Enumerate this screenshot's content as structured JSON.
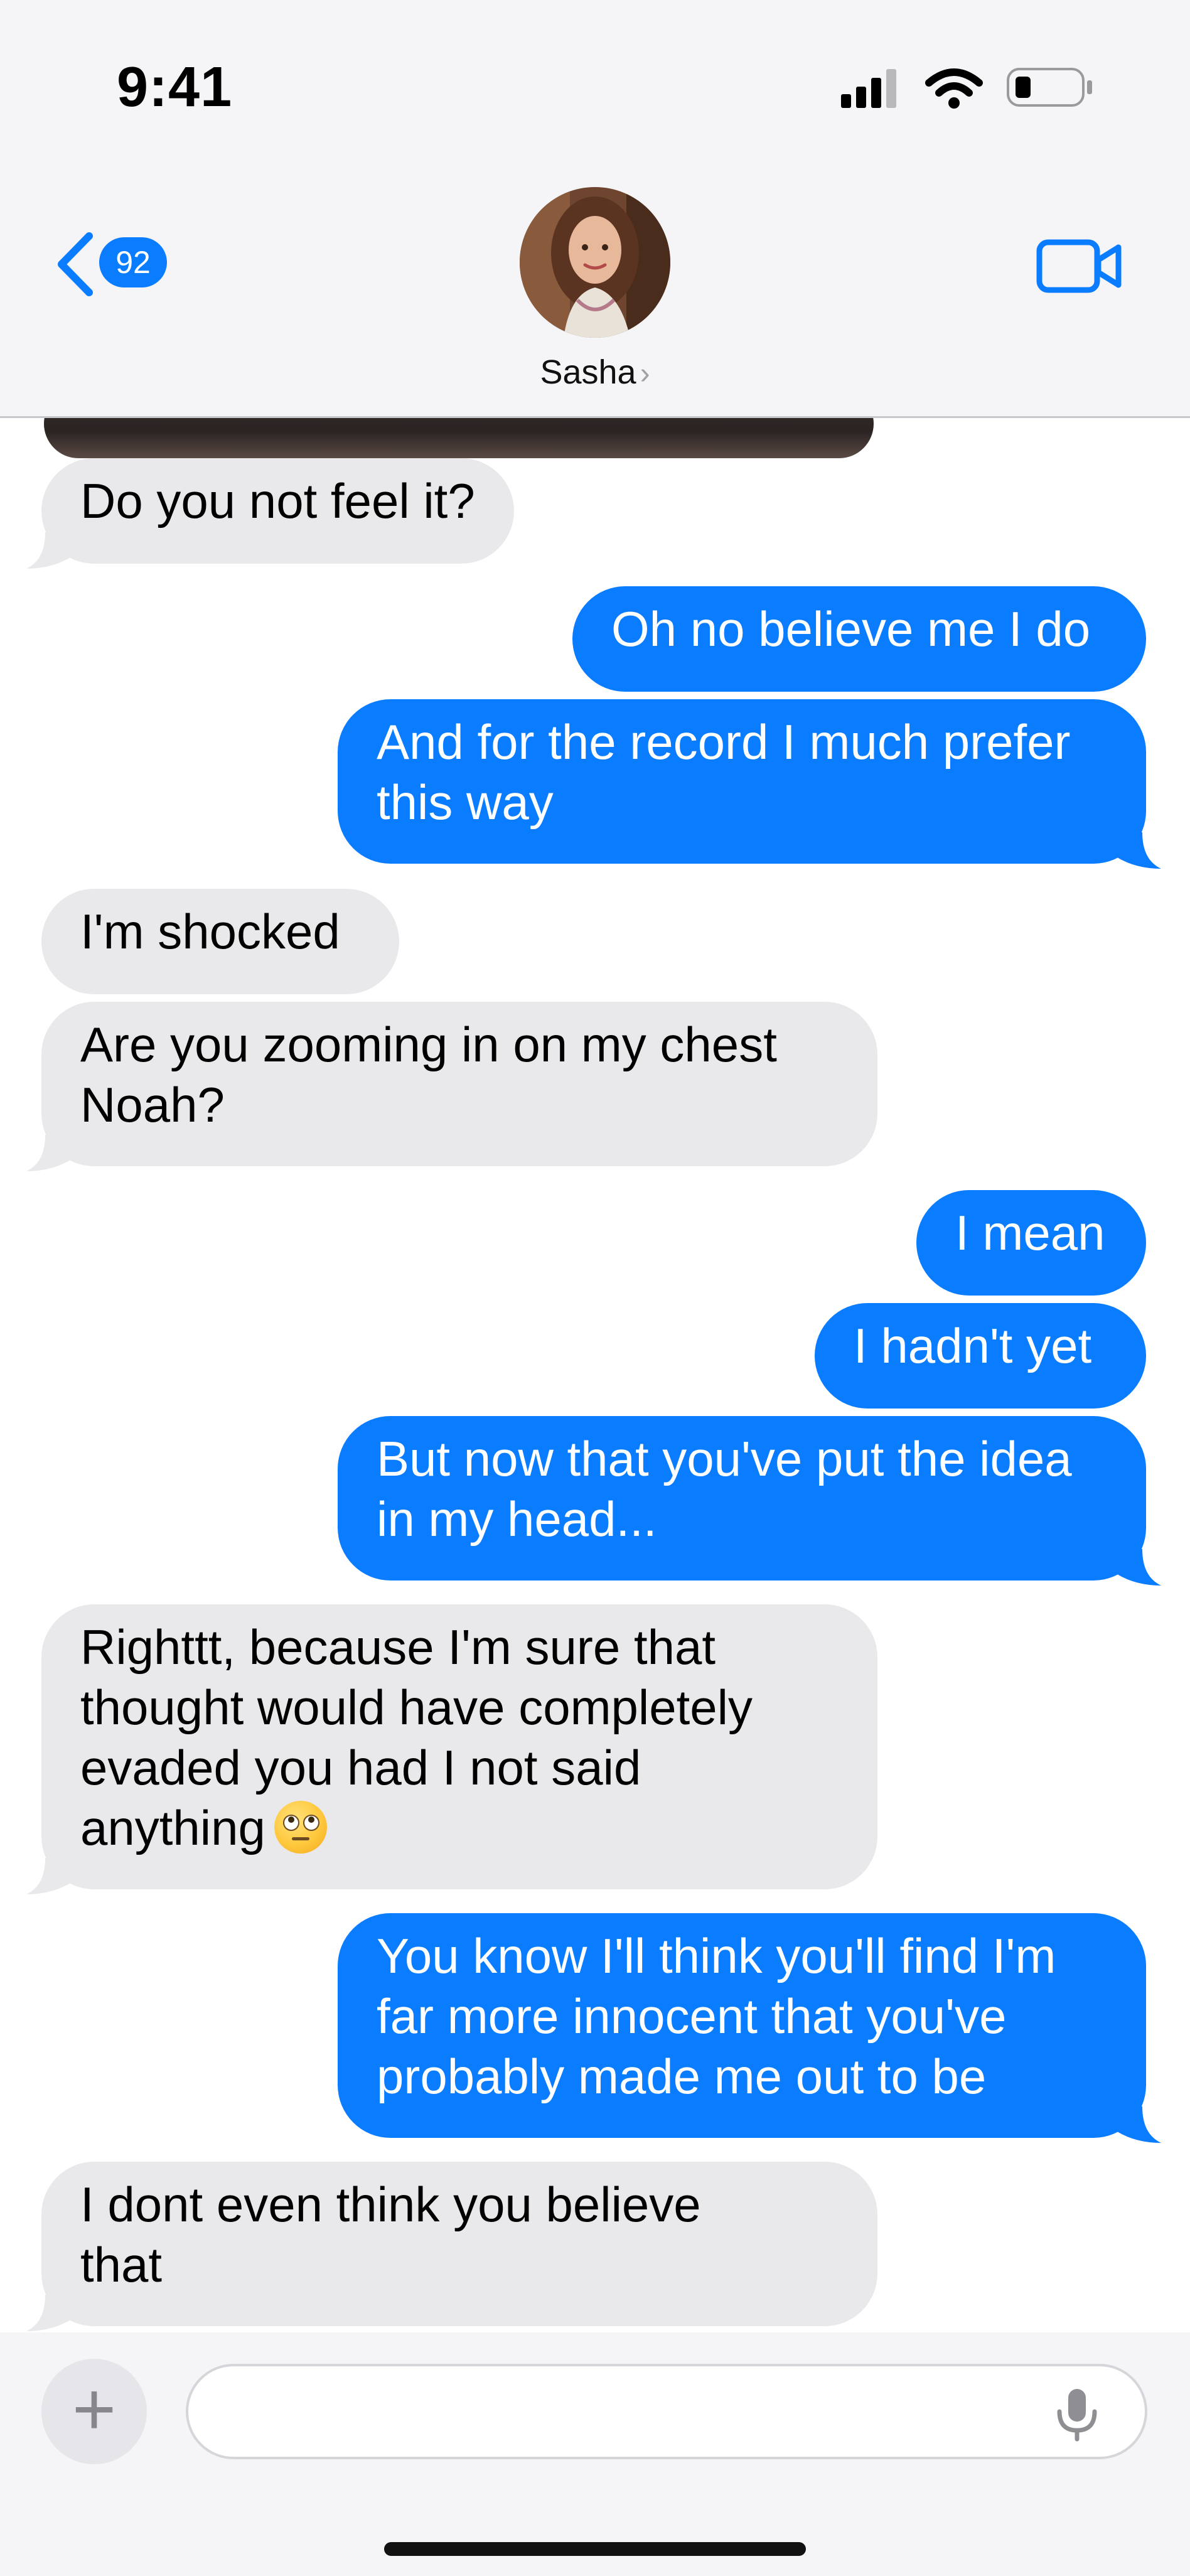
{
  "status_bar": {
    "time": "9:41"
  },
  "header": {
    "back_count": "92",
    "contact_name": "Sasha",
    "chevron": "›",
    "back_icon": "chevron-left-icon",
    "video_icon": "video-camera-icon"
  },
  "colors": {
    "outgoing": "#0a7cff",
    "incoming": "#e9e9eb",
    "accent": "#0a7cff"
  },
  "messages": [
    {
      "dir": "in",
      "text": "Do you not feel it?"
    },
    {
      "dir": "out",
      "text": "Oh no believe me I do"
    },
    {
      "dir": "out",
      "lines": [
        "And for the record I much prefer",
        "this way"
      ]
    },
    {
      "dir": "in",
      "text": "I'm shocked"
    },
    {
      "dir": "in",
      "lines": [
        "Are you zooming in on my chest",
        "Noah?"
      ]
    },
    {
      "dir": "out",
      "text": "I mean"
    },
    {
      "dir": "out",
      "text": "I hadn't yet"
    },
    {
      "dir": "out",
      "lines": [
        "But now that you've put the idea",
        "in my head..."
      ]
    },
    {
      "dir": "in",
      "lines": [
        "Righttt, because I'm sure that",
        "thought would have completely",
        "evaded you had I not said",
        "anything"
      ],
      "emoji": "eye-roll-emoji"
    },
    {
      "dir": "out",
      "lines": [
        "You know I'll think you'll find I'm",
        "far more innocent that you've",
        "probably made me out to be"
      ]
    },
    {
      "dir": "in",
      "lines": [
        "I dont even think you believe",
        "that"
      ]
    }
  ],
  "composer": {
    "plus_label": "+",
    "input_value": "",
    "mic_icon": "microphone-icon"
  }
}
